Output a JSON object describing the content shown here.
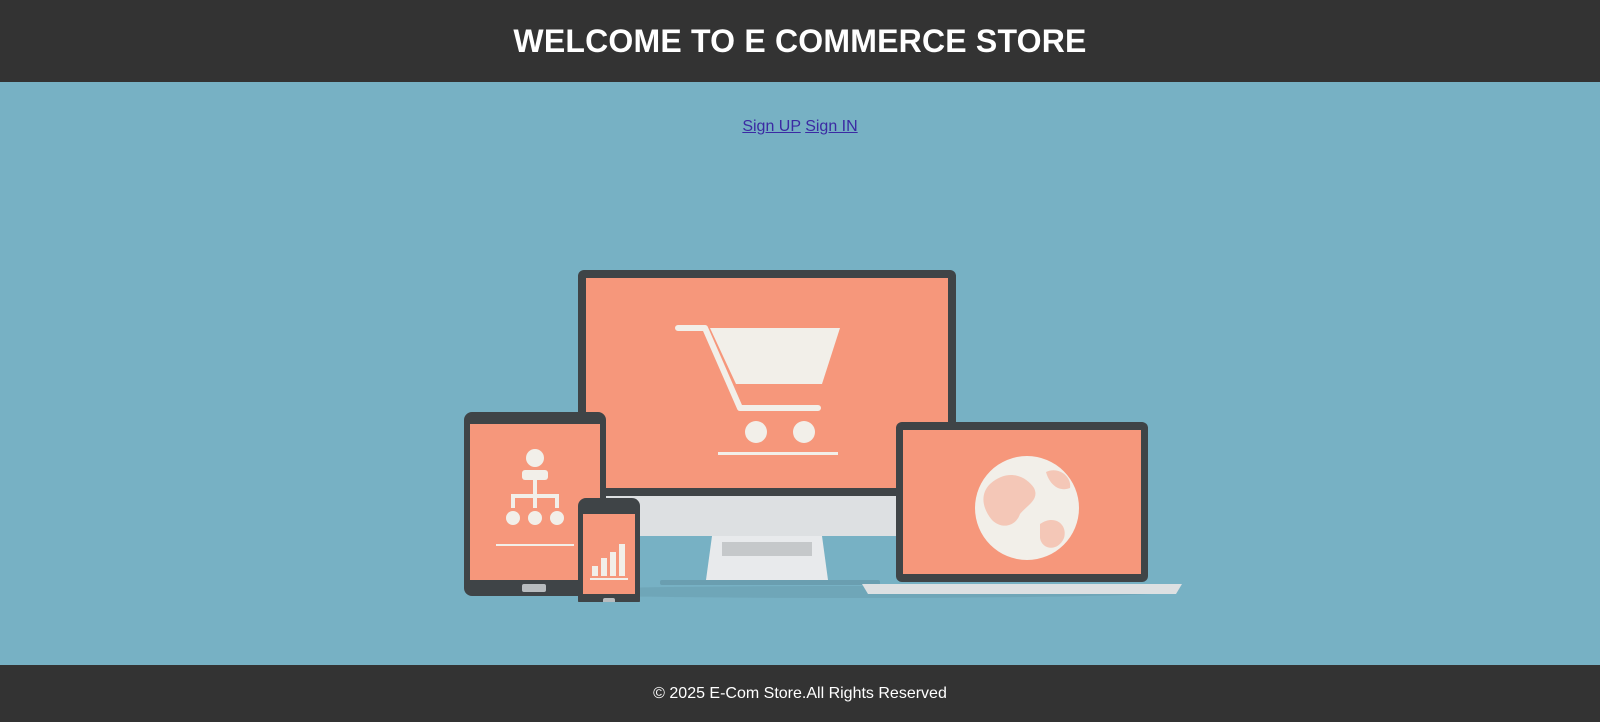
{
  "header": {
    "title": "WELCOME TO E COMMERCE STORE"
  },
  "nav": {
    "signup_label": "Sign UP",
    "signin_label": "Sign IN"
  },
  "hero": {
    "icons": [
      "shopping-cart-icon",
      "org-chart-icon",
      "bar-chart-icon",
      "globe-icon"
    ]
  },
  "footer": {
    "copyright": "© 2025 E-Com Store.All Rights Reserved"
  },
  "colors": {
    "header_bg": "#333333",
    "main_bg": "#77b1c4",
    "screen": "#f6977b",
    "device_frame": "#3f4447",
    "link": "#3b2aa3"
  }
}
